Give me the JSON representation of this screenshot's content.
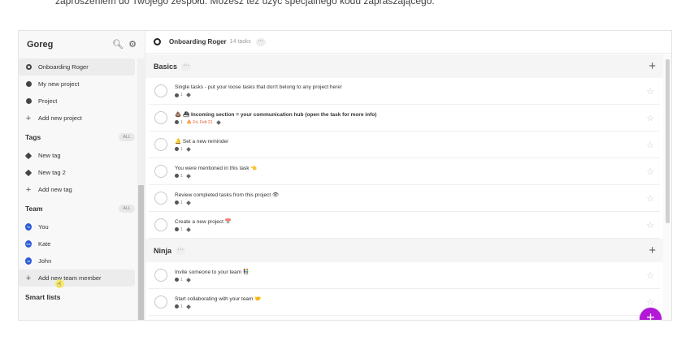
{
  "caption": "zaproszeniem do Twojego zespołu. Możesz też użyć specjalnego kodu zapraszającego.",
  "sidebar": {
    "workspace": "Goreg",
    "projects": [
      {
        "label": "Onboarding Roger",
        "icon": "ring-icon",
        "active": true
      },
      {
        "label": "My new project",
        "icon": "dot-icon"
      },
      {
        "label": "Project",
        "icon": "dot-icon"
      }
    ],
    "add_project": "Add new project",
    "tags_title": "Tags",
    "tags_all": "ALL",
    "tags": [
      "New tag",
      "New tag 2"
    ],
    "add_tag": "Add new tag",
    "team_title": "Team",
    "team_all": "ALL",
    "team": [
      {
        "label": "You",
        "initials": "Yo"
      },
      {
        "label": "Kate",
        "initials": "Ka"
      },
      {
        "label": "John",
        "initials": "Jo"
      }
    ],
    "add_member": "Add new team member",
    "smart_lists": "Smart lists"
  },
  "header": {
    "title": "Onboarding Roger",
    "count": "14 tasks",
    "more": "···"
  },
  "sections": [
    {
      "name": "Basics",
      "more": "···",
      "tasks": [
        {
          "title": "Single tasks - put your loose tasks that don't belong to any project here!",
          "count": "1"
        },
        {
          "title": "💩 ⛴ Incoming section = your communication hub (open the task for more info)",
          "count": "1",
          "due": "Fri, Feb 21",
          "bold": true
        },
        {
          "title": "🔔 Set a new reminder",
          "count": "1"
        },
        {
          "title": "You were mentioned in this task 👈",
          "count": "1"
        },
        {
          "title": "Review completed tasks from this project 👁",
          "count": "1"
        },
        {
          "title": "Create a new project 📅",
          "count": "1"
        }
      ]
    },
    {
      "name": "Ninja",
      "more": "···",
      "tasks": [
        {
          "title": "Invite someone to your team 👫",
          "count": "1"
        },
        {
          "title": "Start collaborating with your team 🤝",
          "count": "1"
        }
      ]
    }
  ],
  "colors": {
    "accent": "#b218d8",
    "avatar": "#2a5bd7",
    "due": "#e8542a"
  }
}
